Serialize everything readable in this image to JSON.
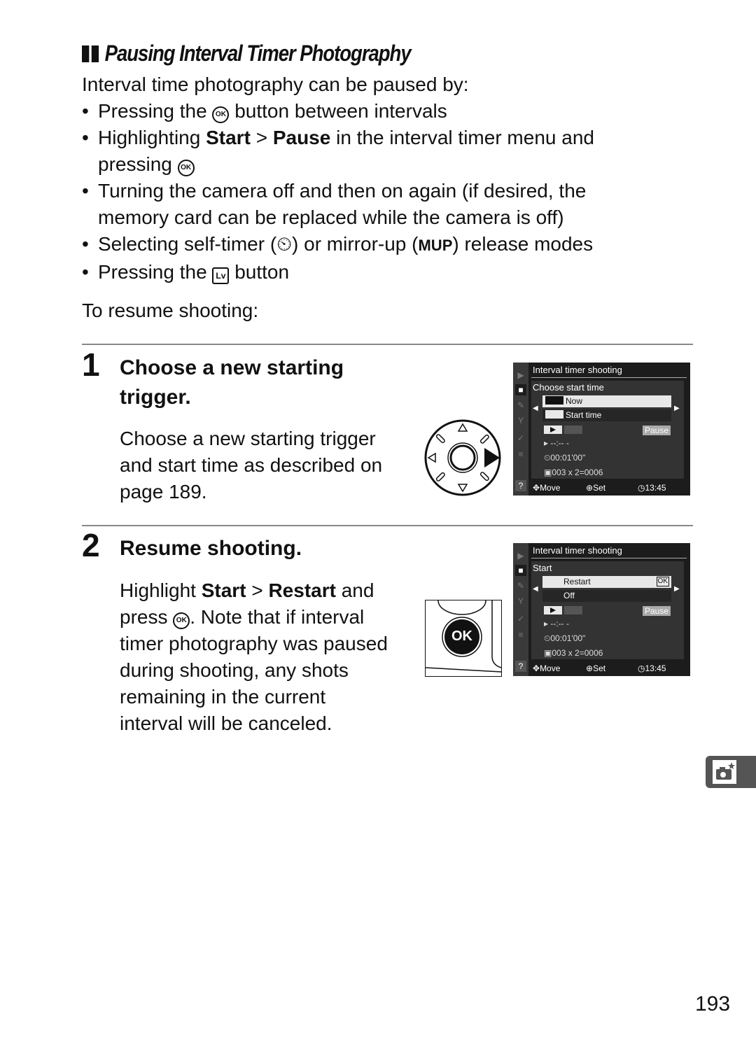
{
  "heading": "Pausing Interval Timer Photography",
  "intro": "Interval time photography can be paused by:",
  "bullets": {
    "b1_pre": "Pressing the",
    "b1_post": "button between intervals",
    "b2_pre": "Highlighting",
    "b2_bold1": "Start",
    "b2_sep": ">",
    "b2_bold2": "Pause",
    "b2_post": "in the interval timer menu and",
    "b2_line2": "pressing",
    "b3_line1": "Turning the camera off and then on again (if desired, the",
    "b3_line2": "memory card can be replaced while the camera is off)",
    "b4_pre": "Selecting self-timer (",
    "b4_mid": ") or mirror-up (",
    "b4_mup": "MUP",
    "b4_post": ") release modes",
    "b5_pre": "Pressing the",
    "b5_post": "button",
    "bullet_char": "•"
  },
  "glyphs": {
    "ok": "OK",
    "lv": "Lv",
    "self_timer": "⏲"
  },
  "resume_label": "To resume shooting:",
  "steps": [
    {
      "number": "1",
      "title_line1": "Choose a new starting",
      "title_line2": "trigger.",
      "body": [
        "Choose a new starting trigger",
        "and start time as described on",
        "page 189."
      ]
    },
    {
      "number": "2",
      "title": "Resume shooting.",
      "body_l1_pre": "Highlight",
      "body_l1_bold1": "Start",
      "body_l1_sep": ">",
      "body_l1_bold2": "Restart",
      "body_l1_post": "and",
      "body_l2_pre": "press",
      "body_l2_post": ".  Note that if interval",
      "body_rest": [
        "timer photography was paused",
        "during shooting, any shots",
        "remaining in the current",
        "interval will be canceled."
      ]
    }
  ],
  "screen1": {
    "title": "Interval timer shooting",
    "subtitle": "Choose start time",
    "options": [
      "Now",
      "Start time"
    ],
    "selected": "Now",
    "pause": "Pause",
    "start_time": "--:-- -",
    "interval": "00:01'00\"",
    "shots": "003 x 2=0006",
    "foot_move": "Move",
    "foot_set": "Set",
    "clock": "13:45"
  },
  "screen2": {
    "title": "Interval timer shooting",
    "subtitle": "Start",
    "options": [
      "Restart",
      "Off"
    ],
    "selected": "Restart",
    "ok_badge": "OK",
    "pause": "Pause",
    "start_time": "--:-- -",
    "interval": "00:01'00\"",
    "shots": "003 x 2=0006",
    "foot_move": "Move",
    "foot_set": "Set",
    "clock": "13:45"
  },
  "ok_button_label": "OK",
  "page_number": "193"
}
